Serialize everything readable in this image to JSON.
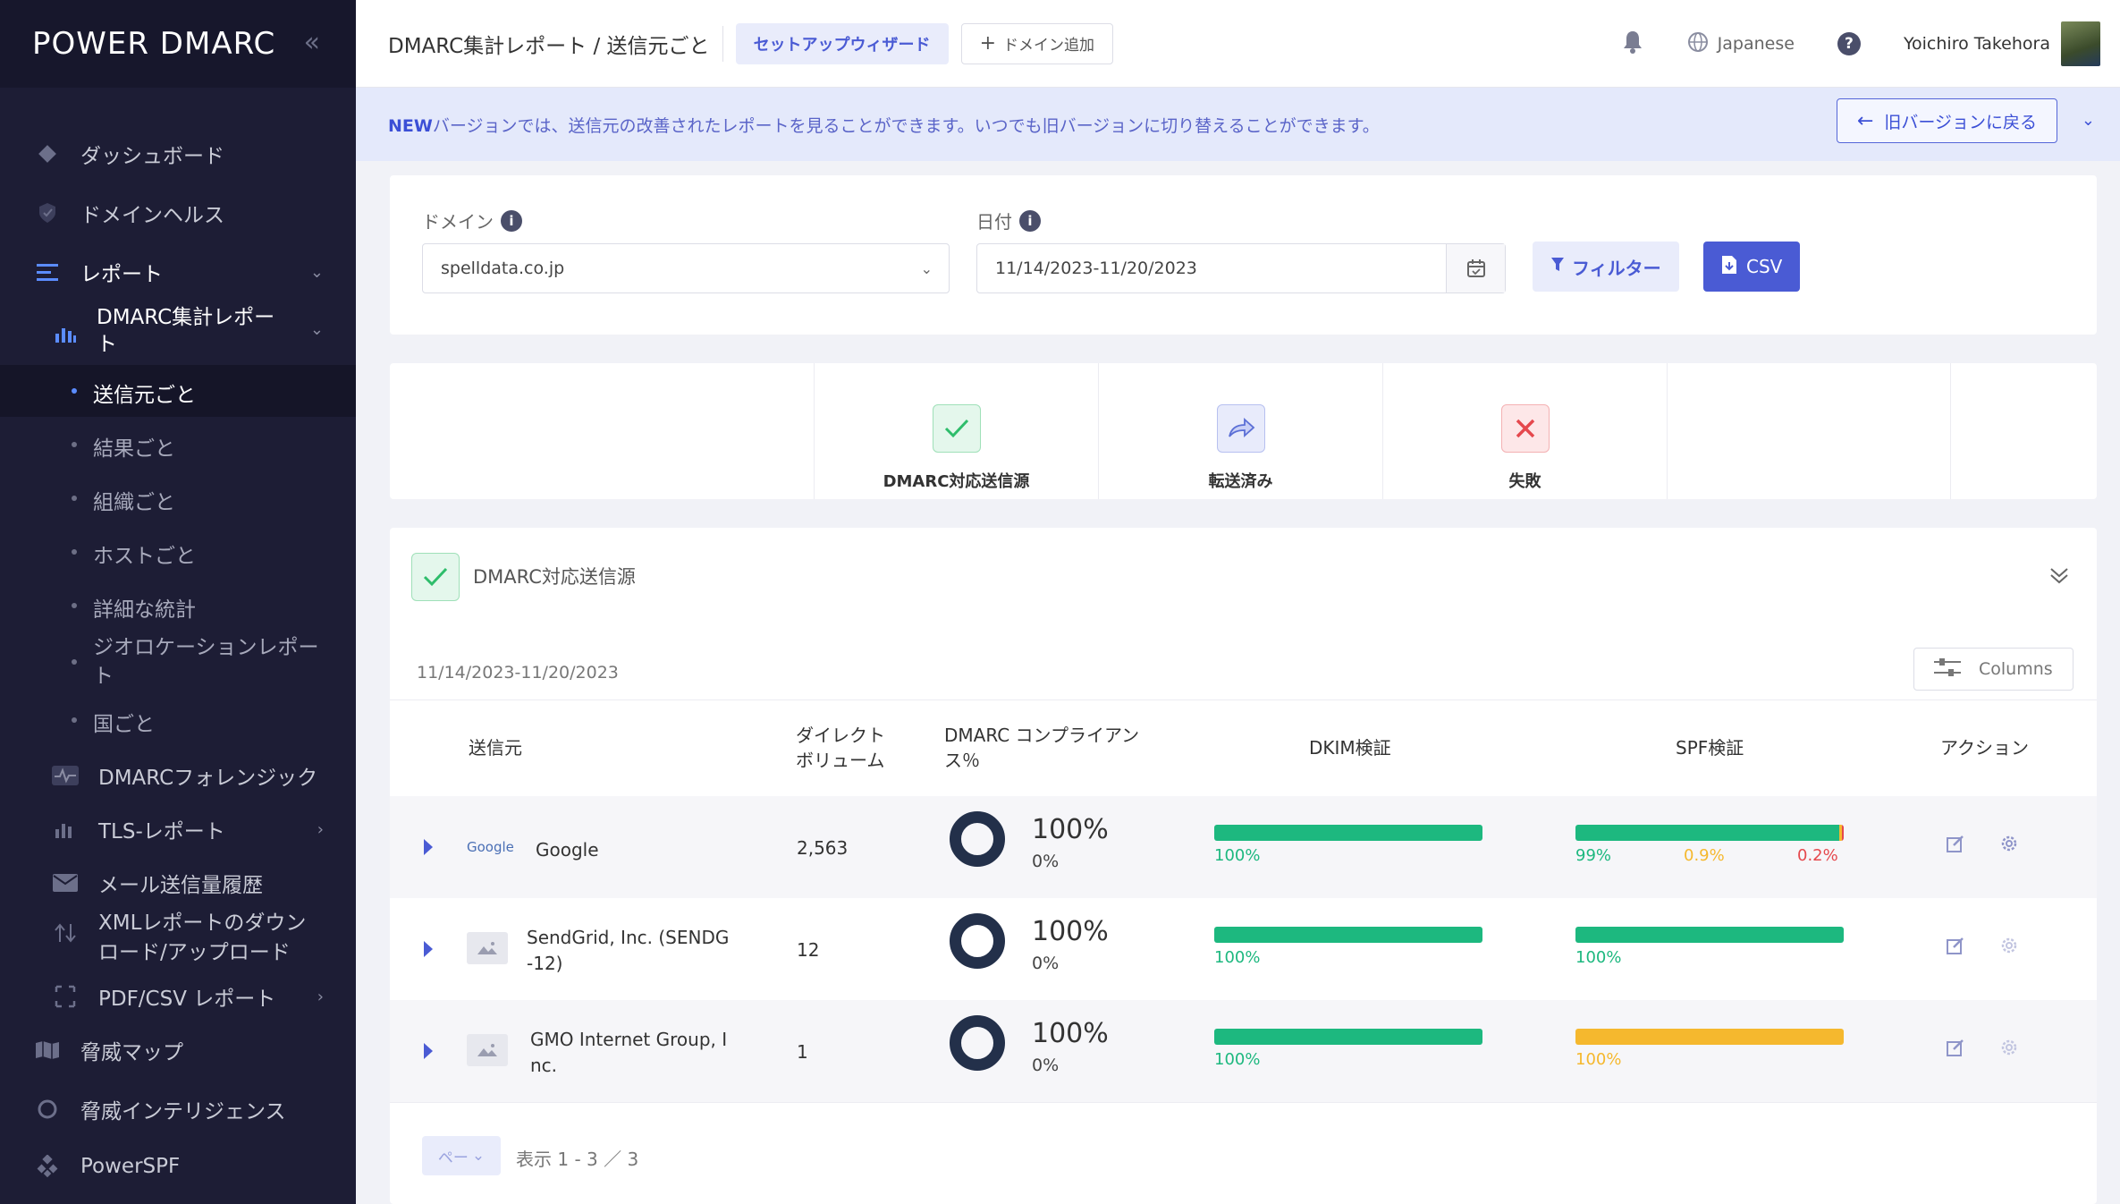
{
  "sidebar": {
    "logo": "POWER DMARC",
    "items": [
      {
        "label": "ダッシュボード",
        "icon": "diamond-icon"
      },
      {
        "label": "ドメインヘルス",
        "icon": "shield-check-icon"
      },
      {
        "label": "レポート",
        "icon": "menu-lines-icon"
      },
      {
        "label": "DMARC集計レポート",
        "icon": "bar-chart-icon"
      },
      {
        "label": "DMARCフォレンジック",
        "icon": "pulse-icon"
      },
      {
        "label": "TLS-レポート",
        "icon": "bar-chart-icon"
      },
      {
        "label": "メール送信量履歴",
        "icon": "mail-icon"
      },
      {
        "label": "XMLレポートのダウンロード/アップロード",
        "icon": "transfer-icon"
      },
      {
        "label": "PDF/CSV レポート",
        "icon": "document-icon"
      },
      {
        "label": "脅威マップ",
        "icon": "map-icon"
      },
      {
        "label": "脅威インテリジェンス",
        "icon": "target-icon"
      },
      {
        "label": "PowerSPF",
        "icon": "nodes-icon"
      }
    ],
    "sub_items": [
      "送信元ごと",
      "結果ごと",
      "組織ごと",
      "ホストごと",
      "詳細な統計",
      "ジオロケーションレポート",
      "国ごと"
    ]
  },
  "header": {
    "title": "DMARC集計レポート / 送信元ごと",
    "wizard_label": "セットアップウィザード",
    "add_domain_label": "ドメイン追加",
    "language": "Japanese",
    "user_name": "Yoichiro Takehora"
  },
  "banner": {
    "new_tag": "NEW",
    "text": "バージョンでは、送信元の改善されたレポートを見ることができます。いつでも旧バージョンに切り替えることができます。",
    "old_version_label": "旧バージョンに戻る"
  },
  "filters": {
    "domain_label": "ドメイン",
    "domain_value": "spelldata.co.jp",
    "date_label": "日付",
    "date_value": "11/14/2023-11/20/2023",
    "filter_label": "フィルター",
    "csv_label": "CSV"
  },
  "summary_tiles": [
    {
      "label": "DMARC対応送信源",
      "icon": "check-icon",
      "color": "#2ebd6b"
    },
    {
      "label": "転送済み",
      "icon": "forward-arrow-icon",
      "color": "#5b6fd6"
    },
    {
      "label": "失敗",
      "icon": "x-icon",
      "color": "#e5484d"
    }
  ],
  "section": {
    "title": "DMARC対応送信源",
    "date_range": "11/14/2023-11/20/2023",
    "columns_label": "Columns"
  },
  "table": {
    "headers": {
      "sender": "送信元",
      "volume": "ダイレクト\nボリューム",
      "compliance": "DMARC コンプライアン\nス％",
      "dkim": "DKIM検証",
      "spf": "SPF検証",
      "action": "アクション"
    },
    "rows": [
      {
        "logo_text": "Google",
        "sender": "Google",
        "volume": "2,563",
        "compliance": "100%",
        "compliance_fail": "0%",
        "dkim": [
          {
            "value": 100,
            "label": "100%",
            "color": "#1db87f"
          }
        ],
        "spf": [
          {
            "value": 99,
            "label": "99%",
            "color": "#1db87f"
          },
          {
            "value": 0.9,
            "label": "0.9%",
            "color": "#f5b82e"
          },
          {
            "value": 0.2,
            "label": "0.2%",
            "color": "#e5484d"
          }
        ]
      },
      {
        "logo_text": "",
        "sender": "SendGrid, Inc. (SENDG\n-12)",
        "volume": "12",
        "compliance": "100%",
        "compliance_fail": "0%",
        "dkim": [
          {
            "value": 100,
            "label": "100%",
            "color": "#1db87f"
          }
        ],
        "spf": [
          {
            "value": 100,
            "label": "100%",
            "color": "#1db87f"
          }
        ]
      },
      {
        "logo_text": "",
        "sender": "GMO Internet Group, I\nnc.",
        "volume": "1",
        "compliance": "100%",
        "compliance_fail": "0%",
        "dkim": [
          {
            "value": 100,
            "label": "100%",
            "color": "#1db87f"
          }
        ],
        "spf": [
          {
            "value": 100,
            "label": "100%",
            "color": "#f5b82e"
          }
        ]
      }
    ]
  },
  "pagination": {
    "per_page_label": "ペー",
    "summary": "表示 1 - 3 ／ 3"
  }
}
